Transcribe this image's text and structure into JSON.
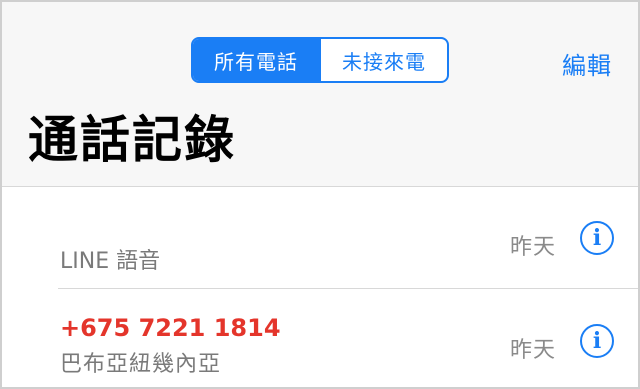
{
  "header": {
    "segments": [
      {
        "label": "所有電話",
        "active": true
      },
      {
        "label": "未接來電",
        "active": false
      }
    ],
    "edit_label": "編輯",
    "title": "通話記錄"
  },
  "calls": [
    {
      "name": "LINE 語音",
      "subtitle": "",
      "time": "昨天",
      "missed": false,
      "info_icon": "info-icon"
    },
    {
      "name": "+675 7221 1814",
      "subtitle": "巴布亞紐幾內亞",
      "time": "昨天",
      "missed": true,
      "info_icon": "info-icon"
    }
  ],
  "colors": {
    "accent": "#1a7ef5",
    "missed": "#e4352b",
    "secondary_text": "#7a7a7a",
    "header_bg": "#f7f7f7"
  }
}
